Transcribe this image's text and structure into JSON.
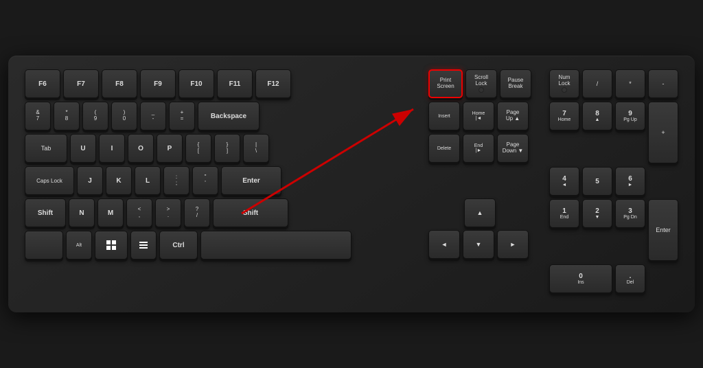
{
  "keyboard": {
    "title": "Keyboard with Print Screen highlighted",
    "rows": {
      "fn_row": [
        "F6",
        "F7",
        "F8",
        "F9",
        "F10",
        "F11",
        "F12"
      ],
      "highlighted_key": "Print Screen"
    },
    "keys": {
      "print_screen": {
        "top": "Print",
        "bottom": "Screen"
      },
      "scroll_lock": {
        "top": "Scroll",
        "bottom": "Lock"
      },
      "pause_break": {
        "top": "Pause",
        "bottom": "Break"
      },
      "backspace": "Backspace",
      "insert": "Insert",
      "home": "Home",
      "page_up": {
        "top": "Page",
        "bottom": "Up"
      },
      "delete": "Delete",
      "end": "End",
      "page_down": {
        "top": "Page",
        "bottom": "Down"
      },
      "num_lock": {
        "top": "Num",
        "bottom": "Lock"
      },
      "enter": "Enter",
      "shift": "Shift",
      "ctrl": "Ctrl",
      "alt": "Alt"
    }
  }
}
